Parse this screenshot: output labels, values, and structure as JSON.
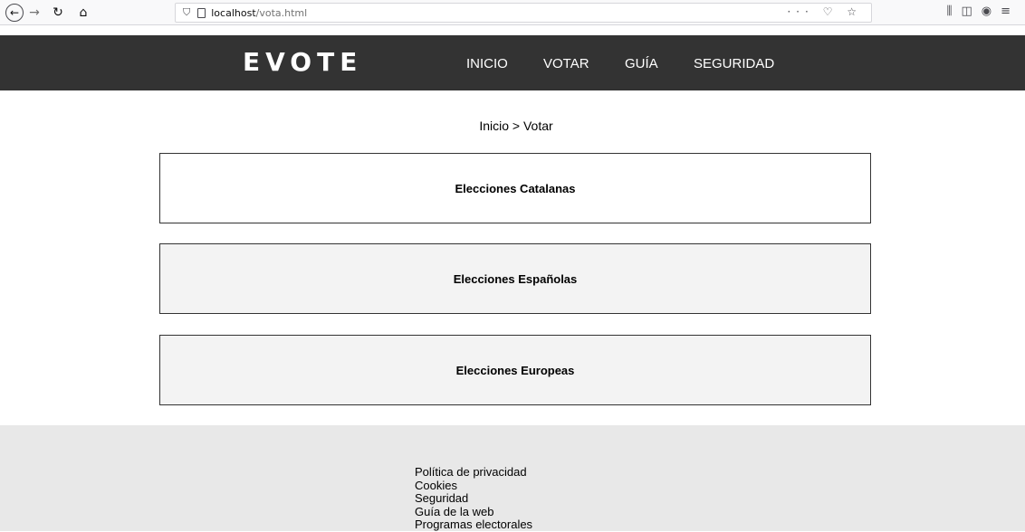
{
  "browser": {
    "url_host": "localhost",
    "url_path": "/vota.html",
    "icons": [
      "back-icon",
      "forward-icon",
      "reload-icon",
      "home-icon",
      "shield-icon",
      "page-icon",
      "more-icon",
      "pocket-icon",
      "bookmark-star-icon",
      "library-icon",
      "sidebar-icon",
      "account-icon",
      "menu-icon"
    ]
  },
  "header": {
    "logo": "EVOTE",
    "nav": [
      "INICIO",
      "VOTAR",
      "GUÍA",
      "SEGURIDAD"
    ]
  },
  "breadcrumb": "Inicio > Votar",
  "elections": [
    "Elecciones Catalanas",
    "Elecciones Españolas",
    "Elecciones Europeas"
  ],
  "footer": {
    "links": [
      "Política de privacidad",
      "Cookies",
      "Seguridad",
      "Guía de la web",
      "Programas electorales"
    ]
  },
  "colors": {
    "header_bg": "#333333",
    "footer_bg": "#e8e8e8",
    "card_alt_bg": "#f3f3f3"
  }
}
